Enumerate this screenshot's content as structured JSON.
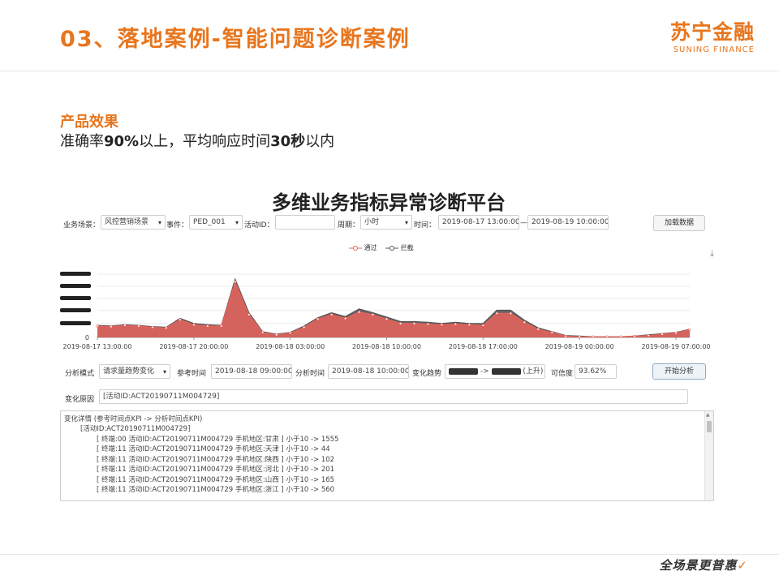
{
  "slide": {
    "title": "03、落地案例-智能问题诊断案例",
    "logo_cn": "苏宁金融",
    "logo_en": "SUNING FINANCE",
    "subheading": "产品效果",
    "desc_prefix": "准确率",
    "desc_accuracy": "90%",
    "desc_mid": "以上，平均响应时间",
    "desc_time": "30秒",
    "desc_suffix": "以内",
    "footer_slogan": "全场景更普惠",
    "accent_color": "#e8761e"
  },
  "platform": {
    "title": "多维业务指标异常诊断平台",
    "filters": {
      "scene_label": "业务场景：",
      "scene_value": "风控营销场景",
      "event_label": "事件：",
      "event_value": "PED_001",
      "activity_label": "活动ID：",
      "activity_value": "",
      "period_label": "周期：",
      "period_value": "小时",
      "time_label": "时间：",
      "time_start": "2019-08-17 13:00:00",
      "time_sep": "—",
      "time_end": "2019-08-19 10:00:00",
      "load_button": "加载数据"
    },
    "legend": [
      {
        "name": "通过",
        "color": "#e8625c"
      },
      {
        "name": "拦截",
        "color": "#555555"
      }
    ],
    "download_icon": "download-icon",
    "analysis": {
      "mode_label": "分析模式",
      "mode_value": "请求量趋势变化",
      "ref_label": "参考时间",
      "ref_value": "2019-08-18 09:00:00",
      "analysis_time_label": "分析时间",
      "analysis_time_value": "2019-08-18 10:00:00",
      "trend_label": "变化趋势",
      "trend_arrow": "->",
      "trend_direction": "(上升)",
      "confidence_label": "可信度",
      "confidence_value": "93.62%",
      "start_button": "开始分析"
    },
    "reason": {
      "label": "变化原因",
      "value": "[活动ID:ACT20190711M004729]"
    },
    "details": {
      "header": "变化详情 (参考时间点KPI -> 分析时间点KPI)",
      "group": "[活动ID:ACT20190711M004729]",
      "lines": [
        "[ 终端:00 活动ID:ACT20190711M004729 手机地区:甘肃 ] 小于10 -> 1555",
        "[ 终端:11 活动ID:ACT20190711M004729 手机地区:天津 ] 小于10 -> 44",
        "[ 终端:11 活动ID:ACT20190711M004729 手机地区:陕西 ] 小于10 -> 102",
        "[ 终端:11 活动ID:ACT20190711M004729 手机地区:河北 ] 小于10 -> 201",
        "[ 终端:11 活动ID:ACT20190711M004729 手机地区:山西 ] 小于10 -> 165",
        "[ 终端:11 活动ID:ACT20190711M004729 手机地区:浙江 ] 小于10 -> 560"
      ]
    }
  },
  "chart_data": {
    "type": "area",
    "x_ticks": [
      "2019-08-17 13:00:00",
      "2019-08-17 20:00:00",
      "2019-08-18 03:00:00",
      "2019-08-18 10:00:00",
      "2019-08-18 17:00:00",
      "2019-08-19 00:00:00",
      "2019-08-19 07:00:00"
    ],
    "y_tick_zero": "0",
    "ylim": [
      0,
      1
    ],
    "grid": true,
    "series": [
      {
        "name": "拦截",
        "color": "#555555",
        "values": [
          0.19,
          0.18,
          0.2,
          0.19,
          0.17,
          0.16,
          0.3,
          0.22,
          0.2,
          0.19,
          0.92,
          0.39,
          0.09,
          0.05,
          0.08,
          0.18,
          0.31,
          0.39,
          0.33,
          0.45,
          0.39,
          0.32,
          0.25,
          0.25,
          0.24,
          0.22,
          0.24,
          0.22,
          0.22,
          0.43,
          0.43,
          0.27,
          0.15,
          0.09,
          0.03,
          0.02,
          0.01,
          0.01,
          0.01,
          0.02,
          0.04,
          0.06,
          0.08,
          0.13
        ]
      },
      {
        "name": "通过",
        "color": "#e8625c",
        "values": [
          0.18,
          0.17,
          0.19,
          0.18,
          0.16,
          0.15,
          0.28,
          0.2,
          0.18,
          0.18,
          0.88,
          0.36,
          0.08,
          0.04,
          0.07,
          0.16,
          0.29,
          0.36,
          0.3,
          0.4,
          0.36,
          0.29,
          0.22,
          0.22,
          0.21,
          0.2,
          0.21,
          0.2,
          0.19,
          0.38,
          0.38,
          0.24,
          0.13,
          0.08,
          0.02,
          0.01,
          0.01,
          0.01,
          0.01,
          0.02,
          0.03,
          0.05,
          0.07,
          0.12
        ]
      }
    ]
  }
}
